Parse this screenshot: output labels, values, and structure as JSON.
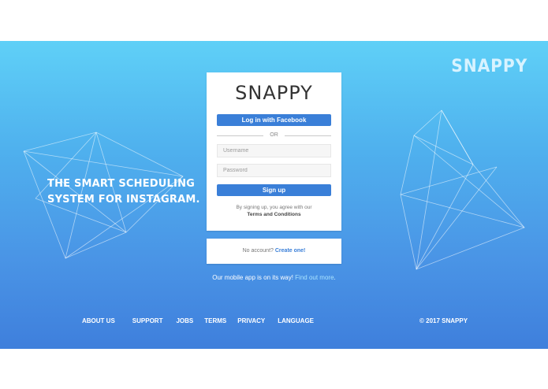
{
  "brand": {
    "name": "SNAPPY"
  },
  "hero": {
    "tagline_line1": "THE SMART SCHEDULING",
    "tagline_line2": "SYSTEM FOR INSTAGRAM."
  },
  "login_card": {
    "logo": "SNAPPY",
    "facebook_button": "Log in with Facebook",
    "or_divider": "OR",
    "username_placeholder": "Username",
    "password_placeholder": "Password",
    "signup_button": "Sign up",
    "terms_prefix": "By signing up, you agree with our",
    "terms_link": "Terms and Conditions"
  },
  "account_card": {
    "prompt": "No account?",
    "create_link": "Create one!"
  },
  "mobile_notice": {
    "text": "Our mobile app is on its way!",
    "link": "Find out more",
    "suffix": "."
  },
  "footer": {
    "links": [
      "ABOUT US",
      "SUPPORT",
      "JOBS",
      "TERMS",
      "PRIVACY",
      "LANGUAGE"
    ],
    "copyright": "© 2017 SNAPPY"
  },
  "colors": {
    "gradient_top": "#5fd0f7",
    "gradient_bottom": "#3f7fdc",
    "button_blue": "#3a7fd8"
  }
}
